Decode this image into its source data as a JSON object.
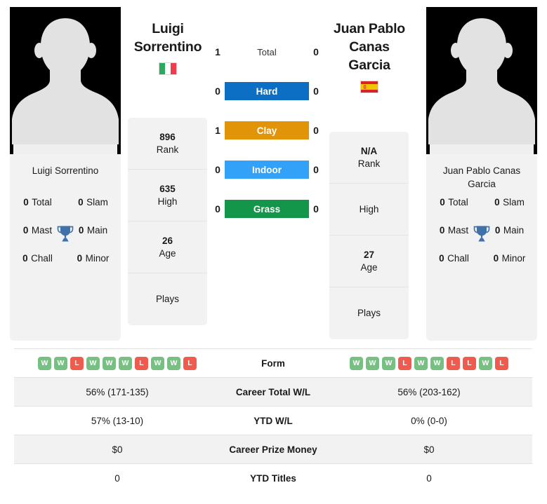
{
  "players": {
    "left": {
      "name_line1": "Luigi",
      "name_line2": "Sorrentino",
      "full_name": "Luigi Sorrentino",
      "country": "Italy",
      "flag_icon": "flag-italy-icon",
      "avatar_icon": "player-avatar-placeholder-icon",
      "rank": "896",
      "rank_label": "Rank",
      "high": "635",
      "high_label": "High",
      "age": "26",
      "age_label": "Age",
      "plays": "",
      "plays_label": "Plays",
      "titles": {
        "total": "0",
        "total_label": "Total",
        "slam": "0",
        "slam_label": "Slam",
        "mast": "0",
        "mast_label": "Mast",
        "main": "0",
        "main_label": "Main",
        "chall": "0",
        "chall_label": "Chall",
        "minor": "0",
        "minor_label": "Minor"
      },
      "form": [
        "W",
        "W",
        "L",
        "W",
        "W",
        "W",
        "L",
        "W",
        "W",
        "L"
      ],
      "career_wl": "56% (171-135)",
      "ytd_wl": "57% (13-10)",
      "career_prize_money": "$0",
      "ytd_titles": "0"
    },
    "right": {
      "name_line1": "Juan Pablo",
      "name_line2": "Canas Garcia",
      "full_name": "Juan Pablo Canas Garcia",
      "country": "Spain",
      "flag_icon": "flag-spain-icon",
      "avatar_icon": "player-avatar-placeholder-icon",
      "rank": "N/A",
      "rank_label": "Rank",
      "high": "",
      "high_label": "High",
      "age": "27",
      "age_label": "Age",
      "plays": "",
      "plays_label": "Plays",
      "titles": {
        "total": "0",
        "total_label": "Total",
        "slam": "0",
        "slam_label": "Slam",
        "mast": "0",
        "mast_label": "Mast",
        "main": "0",
        "main_label": "Main",
        "chall": "0",
        "chall_label": "Chall",
        "minor": "0",
        "minor_label": "Minor"
      },
      "form": [
        "W",
        "W",
        "W",
        "L",
        "W",
        "W",
        "L",
        "L",
        "W",
        "L"
      ],
      "career_wl": "56% (203-162)",
      "ytd_wl": "0% (0-0)",
      "career_prize_money": "$0",
      "ytd_titles": "0"
    }
  },
  "head_to_head": [
    {
      "label": "Total",
      "left": "1",
      "right": "0",
      "style": "plain",
      "color": ""
    },
    {
      "label": "Hard",
      "left": "0",
      "right": "0",
      "style": "bar",
      "color": "#0d6fc4"
    },
    {
      "label": "Clay",
      "left": "1",
      "right": "0",
      "style": "bar",
      "color": "#e19407"
    },
    {
      "label": "Indoor",
      "left": "0",
      "right": "0",
      "style": "bar",
      "color": "#31a2f7"
    },
    {
      "label": "Grass",
      "left": "0",
      "right": "0",
      "style": "bar",
      "color": "#13964a"
    }
  ],
  "stats_rows": [
    {
      "label": "Form",
      "type": "form",
      "left": "",
      "right": ""
    },
    {
      "label": "Career Total W/L",
      "type": "text",
      "left": "56% (171-135)",
      "right": "56% (203-162)"
    },
    {
      "label": "YTD W/L",
      "type": "text",
      "left": "57% (13-10)",
      "right": "0% (0-0)"
    },
    {
      "label": "Career Prize Money",
      "type": "text",
      "left": "$0",
      "right": "$0"
    },
    {
      "label": "YTD Titles",
      "type": "text",
      "left": "0",
      "right": "0"
    }
  ],
  "colors": {
    "hard": "#0d6fc4",
    "clay": "#e19407",
    "indoor": "#31a2f7",
    "grass": "#13964a",
    "win": "#76c082",
    "loss": "#ef5b4c",
    "trophy": "#3f72ab",
    "card_bg": "#f2f2f2"
  }
}
